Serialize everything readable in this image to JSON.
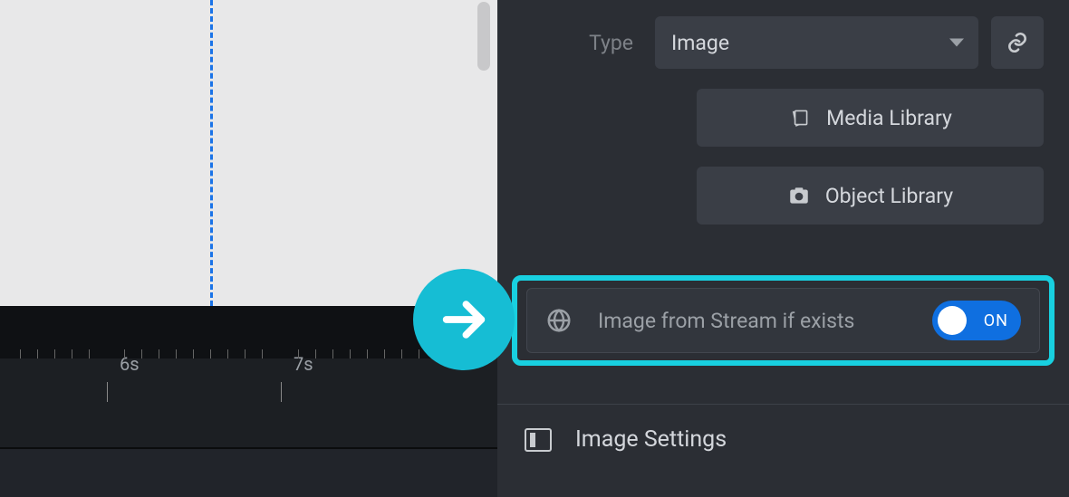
{
  "panel": {
    "type_label": "Type",
    "type_value": "Image",
    "media_library_label": "Media Library",
    "object_library_label": "Object Library",
    "stream_label": "Image from Stream if exists",
    "stream_toggle": "ON",
    "section_title": "Image Settings"
  },
  "timeline": {
    "ticks": [
      "6s",
      "7s"
    ]
  }
}
